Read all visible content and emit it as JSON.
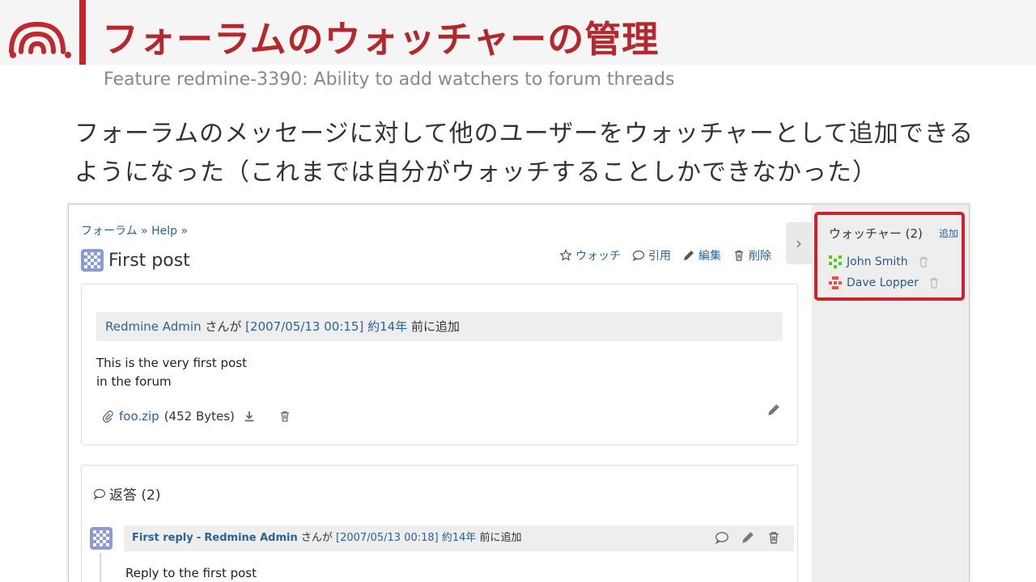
{
  "slide": {
    "title": "フォーラムのウォッチャーの管理",
    "subtitle": "Feature redmine-3390: Ability to add watchers to forum threads",
    "body": "フォーラムのメッセージに対して他のユーザーをウォッチャーとして追加できるようになった（これまでは自分がウォッチすることしかできなかった）"
  },
  "breadcrumb": {
    "forum": "フォーラム",
    "sep1": "»",
    "board": "Help",
    "sep2": "»"
  },
  "post": {
    "title": "First post",
    "actions": {
      "watch": "ウォッチ",
      "quote": "引用",
      "edit": "編集",
      "delete": "削除"
    },
    "author": "Redmine Admin",
    "author_suffix": "さんが",
    "timestamp": "[2007/05/13 00:15]",
    "ago": "約14年",
    "ago_suffix": "前に追加",
    "content_line1": "This is the very first post",
    "content_line2": "in the forum",
    "attachment_name": "foo.zip",
    "attachment_size": "(452 Bytes)"
  },
  "replies": {
    "heading": "返答 (2)",
    "first": {
      "subject": "First reply",
      "separator": "-",
      "author": "Redmine Admin",
      "author_suffix": "さんが",
      "timestamp": "[2007/05/13 00:18]",
      "ago": "約14年",
      "ago_suffix": "前に追加",
      "content": "Reply to the first post"
    }
  },
  "sidebar": {
    "toggle": "›",
    "watchers_title": "ウォッチャー (2)",
    "add_link": "追加",
    "watchers": [
      {
        "name": "John Smith",
        "color": "#5fbf3a"
      },
      {
        "name": "Dave Lopper",
        "color": "#d9534f"
      }
    ]
  },
  "colors": {
    "accent": "#b3282c",
    "highlight_border": "#d0222b",
    "link": "#2a6496"
  }
}
